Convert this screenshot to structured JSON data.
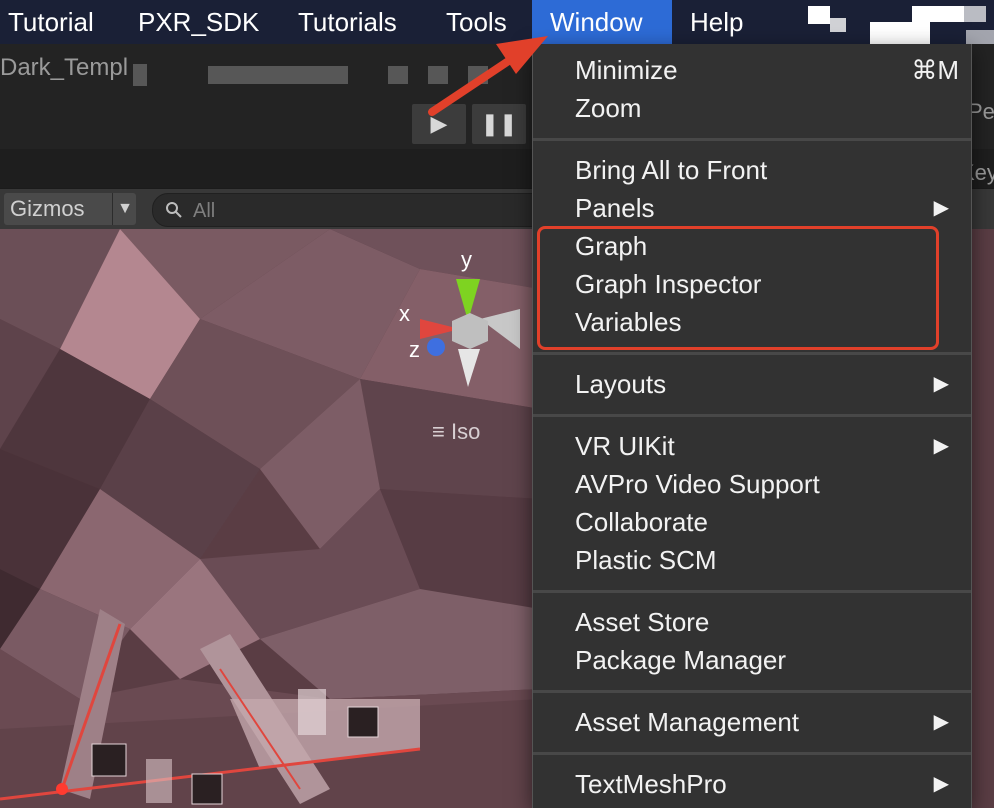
{
  "menubar": {
    "items": [
      "Tutorial",
      "PXR_SDK",
      "Tutorials",
      "Tools",
      "Window",
      "Help"
    ],
    "active": "Window"
  },
  "toolbar": {
    "scene_name": "Dark_Templ",
    "play_icon": "play-icon",
    "pause_icon": "pause-icon",
    "right_edge_label": "Key",
    "right_edge_label_2": "Pe"
  },
  "scene_toolbar": {
    "gizmos_label": "Gizmos",
    "search_placeholder": "All"
  },
  "viewport": {
    "axis_labels": {
      "x": "x",
      "y": "y",
      "z": "z"
    },
    "projection_label": "Iso"
  },
  "window_menu": {
    "groups": [
      [
        {
          "label": "Minimize",
          "shortcut": "⌘M"
        },
        {
          "label": "Zoom"
        }
      ],
      [
        {
          "label": "Bring All to Front"
        },
        {
          "label": "Panels",
          "submenu": true
        },
        {
          "label": "Graph"
        },
        {
          "label": "Graph Inspector"
        },
        {
          "label": "Variables"
        }
      ],
      [
        {
          "label": "Layouts",
          "submenu": true
        }
      ],
      [
        {
          "label": "VR UIKit",
          "submenu": true
        },
        {
          "label": "AVPro Video Support"
        },
        {
          "label": "Collaborate"
        },
        {
          "label": "Plastic SCM"
        }
      ],
      [
        {
          "label": "Asset Store"
        },
        {
          "label": "Package Manager"
        }
      ],
      [
        {
          "label": "Asset Management",
          "submenu": true
        }
      ],
      [
        {
          "label": "TextMeshPro",
          "submenu": true
        }
      ]
    ]
  },
  "colors": {
    "menubar_bg": "#1a2036",
    "active_menu": "#2d6bd6",
    "menu_bg": "#323232",
    "annotation_red": "#e1402a"
  }
}
